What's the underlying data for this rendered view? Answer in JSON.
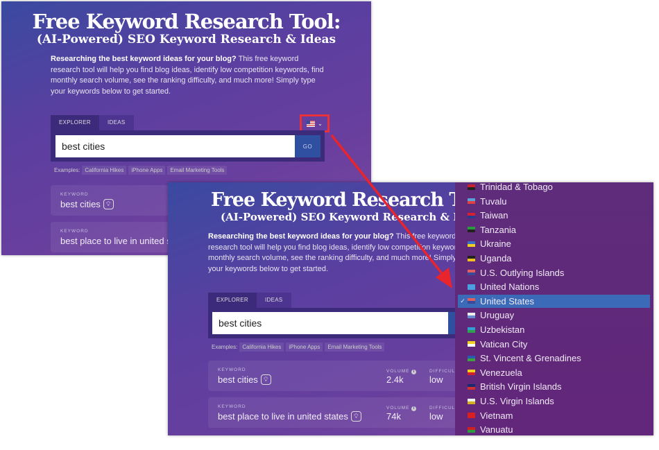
{
  "page": {
    "title": "Free Keyword Research Tool:",
    "subtitle": "(AI-Powered) SEO Keyword Research & Ideas",
    "intro_bold": "Researching the best keyword ideas for your blog?",
    "intro_rest": " This free keyword research tool will help you find blog ideas, identify low competition keywords, find monthly search volume, see the ranking difficulty, and much more! Simply type your keywords below to get started.",
    "tabs": [
      "EXPLORER",
      "IDEAS"
    ],
    "search_value": "best cities",
    "go_label": "GO",
    "examples_label": "Examples:",
    "examples": [
      "California Hikes",
      "iPhone Apps",
      "Email Marketing Tools"
    ],
    "country_selector": {
      "selected_flag": "us-flag-icon",
      "chevron": "chevron-down-icon"
    },
    "results": [
      {
        "keyword_label": "KEYWORD",
        "keyword": "best cities",
        "volume_label": "VOLUME",
        "volume": "2.4k",
        "difficulty_label": "DIFFICULT",
        "difficulty": "low"
      },
      {
        "keyword_label": "KEYWORD",
        "keyword": "best place to live in united states",
        "volume_label": "VOLUME",
        "volume": "74k",
        "difficulty_label": "DIFFICULT",
        "difficulty": "low"
      }
    ]
  },
  "country_dropdown": {
    "selected": "United States",
    "items": [
      {
        "name": "Trinidad & Tobago",
        "flag": [
          "#c8202e",
          "#222"
        ]
      },
      {
        "name": "Tuvalu",
        "flag": [
          "#5aa0d8",
          "#e04040"
        ]
      },
      {
        "name": "Taiwan",
        "flag": [
          "#d82030",
          "#2a3a90"
        ]
      },
      {
        "name": "Tanzania",
        "flag": [
          "#2a9a40",
          "#222"
        ]
      },
      {
        "name": "Ukraine",
        "flag": [
          "#3a70c8",
          "#f0d020"
        ]
      },
      {
        "name": "Uganda",
        "flag": [
          "#222",
          "#f0c020"
        ]
      },
      {
        "name": "U.S. Outlying Islands",
        "flag": [
          "#e06060",
          "#3a4a9a"
        ]
      },
      {
        "name": "United Nations",
        "flag": [
          "#4aa0e0",
          "#4aa0e0"
        ]
      },
      {
        "name": "United States",
        "flag": [
          "#e06060",
          "#3a4a9a"
        ]
      },
      {
        "name": "Uruguay",
        "flag": [
          "#eee",
          "#6a8ad0"
        ]
      },
      {
        "name": "Uzbekistan",
        "flag": [
          "#30a0d0",
          "#30a050"
        ]
      },
      {
        "name": "Vatican City",
        "flag": [
          "#f0d020",
          "#fff"
        ]
      },
      {
        "name": "St. Vincent & Grenadines",
        "flag": [
          "#2a5ab0",
          "#40a040"
        ]
      },
      {
        "name": "Venezuela",
        "flag": [
          "#f0d020",
          "#d02030"
        ]
      },
      {
        "name": "British Virgin Islands",
        "flag": [
          "#1a2a70",
          "#d03030"
        ]
      },
      {
        "name": "U.S. Virgin Islands",
        "flag": [
          "#eee",
          "#d0b020"
        ]
      },
      {
        "name": "Vietnam",
        "flag": [
          "#d82020",
          "#d82020"
        ]
      },
      {
        "name": "Vanuatu",
        "flag": [
          "#d02020",
          "#2a9a40"
        ]
      }
    ]
  },
  "colors": {
    "highlight": "#e8313a",
    "selected_row": "#3a6ab8",
    "go_button": "#2f4fa0"
  }
}
